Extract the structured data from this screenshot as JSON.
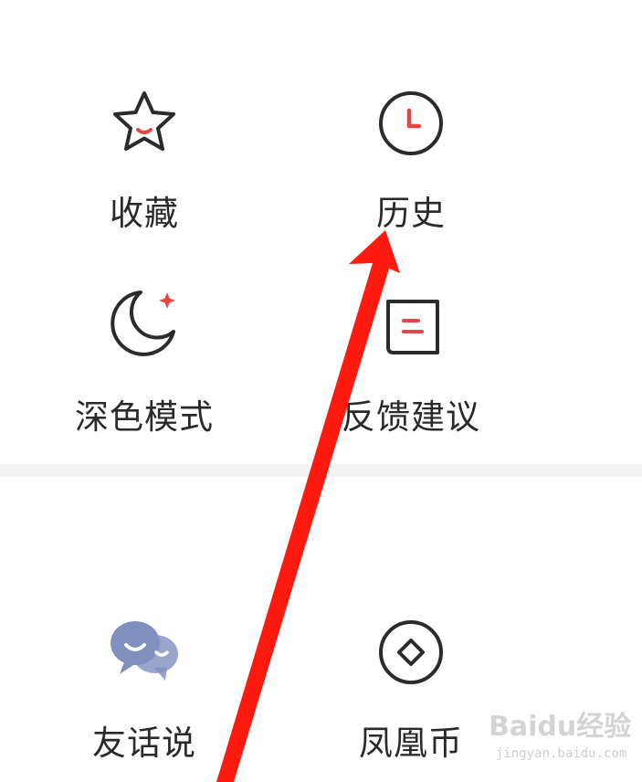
{
  "menu_top": {
    "items": [
      {
        "label": "收藏",
        "icon": "star-icon"
      },
      {
        "label": "历史",
        "icon": "clock-icon"
      },
      {
        "label": "深色模式",
        "icon": "moon-icon"
      },
      {
        "label": "反馈建议",
        "icon": "feedback-icon"
      }
    ]
  },
  "menu_bottom": {
    "items": [
      {
        "label": "友话说",
        "icon": "chat-bubbles-icon"
      },
      {
        "label": "凤凰币",
        "icon": "coin-icon"
      }
    ]
  },
  "colors": {
    "accent_red": "#e5464a",
    "icon_stroke": "#2b2b2b",
    "chat_bubble": "#7f8fbe",
    "annotation_arrow": "#ff1a10",
    "divider": "#f3f3f3"
  },
  "watermark": {
    "brand": "Baidu经验",
    "url": "jingyan.baidu.com"
  }
}
